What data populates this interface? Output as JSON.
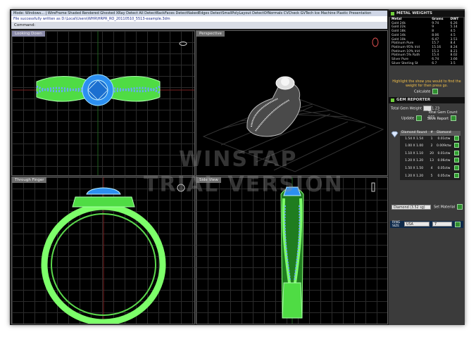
{
  "app": {
    "menu_text": "Mode: Windows... | WireFrame  Shaded  Rendered  Ghosted  XRay  Detect All  DetectBackFaces  DetectNakedEdges  DetectSmallPolyLayout  DetectOfNormals  CVCheck  GVTech  Ice  Machine  Plastic  Presentation",
    "status_text": "File successfully written as D:\\Local\\Users\\WHR\\HRPR_RO_20110510_5513-example.3dm",
    "command_label": "Command:",
    "watermark_line1": "WINSTAP",
    "watermark_line2": "TRIAL VERSION"
  },
  "viewports": {
    "top_left": "Looking Down",
    "top_right": "Perspective",
    "bottom_left": "Through Finger",
    "bottom_right": "Side View"
  },
  "metal_weights": {
    "title": "METAL WEIGHTS",
    "columns": [
      "Metal",
      "Grams",
      "DWT"
    ],
    "rows": [
      [
        "Gold 24k",
        "9.74",
        "6.26"
      ],
      [
        "Gold 22k",
        "9",
        "5.14"
      ],
      [
        "Gold 18k",
        "8",
        "4.5"
      ],
      [
        "Gold 14k",
        "8.06",
        "4.5"
      ],
      [
        "Gold 10k",
        "6.47",
        "3.51"
      ],
      [
        "Platinum Pure",
        "15.7",
        "8.4"
      ],
      [
        "Platinum 95% Irid",
        "15.16",
        "8.24"
      ],
      [
        "Platinum 10% Irid",
        "15.3",
        "8.21"
      ],
      [
        "Platinum 5% Ruth",
        "15.4",
        "8.02"
      ],
      [
        "Silver Pure",
        "6.74",
        "3.66"
      ],
      [
        "Silver Sterling St",
        "6.7",
        "3.5"
      ]
    ],
    "hint": "Highlight the show you would to find the weight for then press go.",
    "calculate_label": "Calculate"
  },
  "gem_reporter": {
    "title": "GEM REPORTER",
    "total_weight_label": "Total Gem Weight",
    "total_weight_value": "1.23",
    "total_count_label": "Total Gem Count",
    "total_count_value": "101",
    "update_label": "Update",
    "save_label": "Save Report",
    "columns": [
      "Diamond Round",
      "#",
      "Diamond"
    ],
    "rows": [
      [
        "1.54 X 1.54",
        "1",
        "0.01ctw"
      ],
      [
        "1.00 X 1.00",
        "2",
        "0.009ctw"
      ],
      [
        "1.10 X 1.10",
        "20",
        "0.01ctw"
      ],
      [
        "1.20 X 1.20",
        "13",
        "0.06ctw"
      ],
      [
        "1.50 X 1.50",
        "4",
        "0.05ctw"
      ],
      [
        "1.20 X 1.20",
        "5",
        "0.05ctw"
      ]
    ],
    "material_value": "Diamond (3.52 sg)",
    "set_material_label": "Set Material"
  },
  "ring_size": {
    "label": "RING SIZE",
    "standard": "USA",
    "value": "7"
  },
  "colors": {
    "wire_green": "#7dff6a",
    "stone_blue": "#6aa7ff",
    "accent_gold": "#f3c04a"
  }
}
